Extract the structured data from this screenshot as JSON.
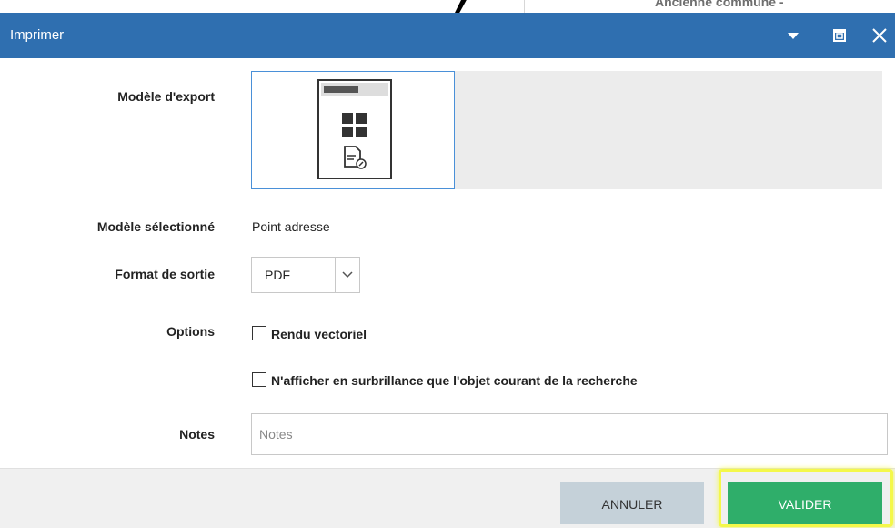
{
  "background": {
    "text": "Ancienne commune   -"
  },
  "dialog": {
    "title": "Imprimer",
    "fields": {
      "export_model_label": "Modèle d'export",
      "selected_model_label": "Modèle sélectionné",
      "selected_model_value": "Point adresse",
      "output_format_label": "Format de sortie",
      "output_format_value": "PDF",
      "options_label": "Options",
      "option_vector": "Rendu vectoriel",
      "option_highlight": "N'afficher en surbrillance que l'objet courant de la recherche",
      "notes_label": "Notes",
      "notes_placeholder": "Notes"
    },
    "buttons": {
      "cancel": "ANNULER",
      "ok": "VALIDER"
    }
  },
  "colors": {
    "titlebar": "#2f6fb0",
    "ok_button": "#2fae6a",
    "cancel_button": "#c5d1d9",
    "highlight": "#f4f84a"
  }
}
